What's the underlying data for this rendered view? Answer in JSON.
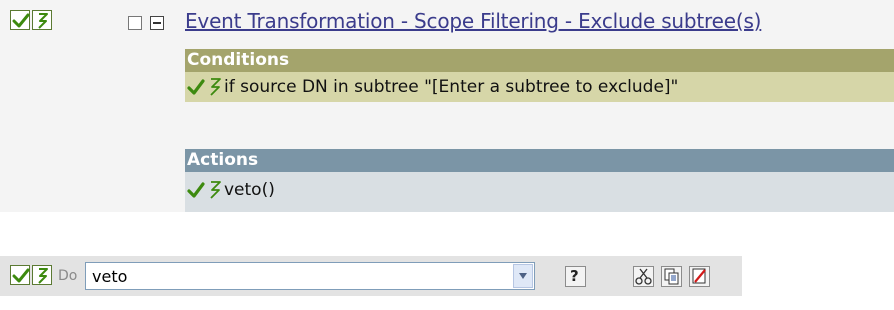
{
  "rule": {
    "title": "Event Transformation - Scope Filtering - Exclude subtree(s)",
    "enabled": true,
    "trace": true
  },
  "conditions": {
    "header": "Conditions",
    "items": [
      {
        "text": "if source DN in subtree \"[Enter a subtree to exclude]\""
      }
    ]
  },
  "actions": {
    "header": "Actions",
    "items": [
      {
        "text": "veto()"
      }
    ]
  },
  "action_editor": {
    "do_label": "Do",
    "selected_action": "veto",
    "help_label": "?"
  },
  "colors": {
    "conditions_header": "#a4a46c",
    "conditions_body": "#d6d6a8",
    "actions_header": "#7b95a6",
    "actions_body": "#d9dfe3",
    "link": "#3b3c8c",
    "check_green": "#4c9a12"
  }
}
